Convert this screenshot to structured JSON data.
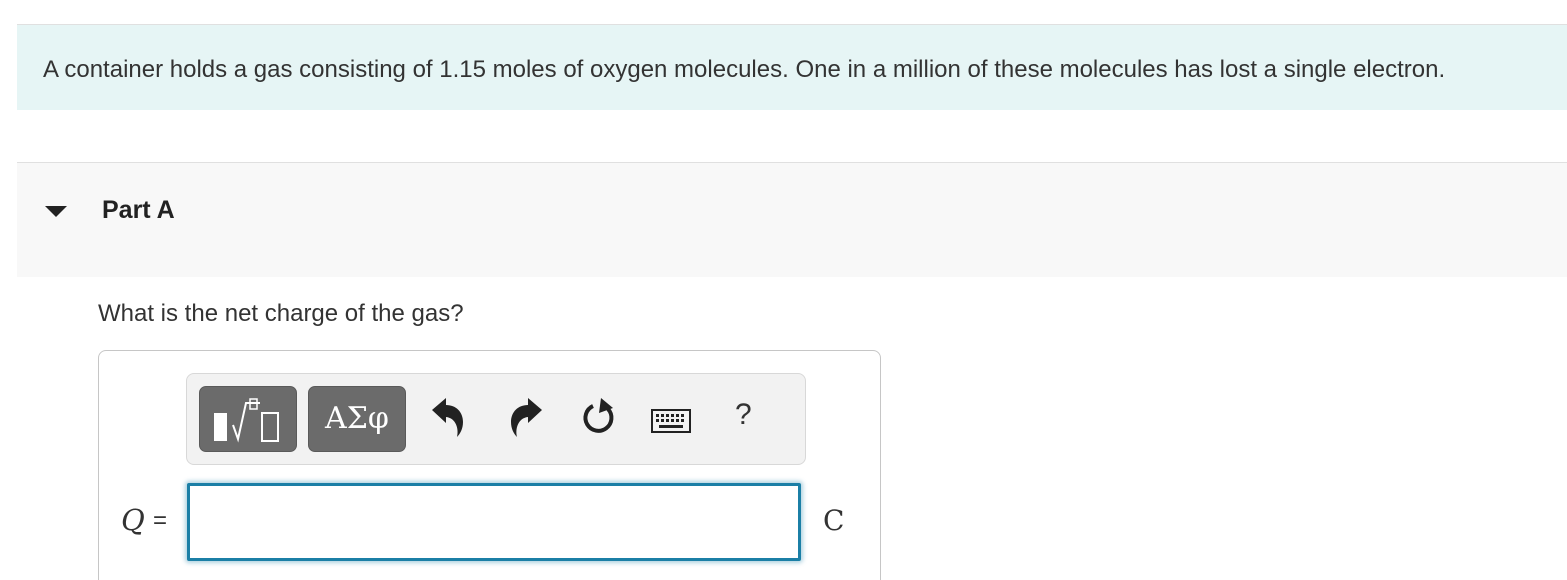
{
  "intro": {
    "text": "A container holds a gas consisting of 1.15 moles of oxygen molecules. One in a million of these molecules has lost a single electron."
  },
  "part": {
    "title": "Part A",
    "question": "What is the net charge of the gas?"
  },
  "toolbar": {
    "templates_icon": "templates-icon",
    "symbols_label": "ΑΣφ",
    "undo_icon": "undo-icon",
    "redo_icon": "redo-icon",
    "reset_icon": "reset-icon",
    "keyboard_icon": "keyboard-icon",
    "help_label": "?"
  },
  "answer": {
    "variable": "Q",
    "equals": "=",
    "value": "",
    "unit": "C"
  },
  "colors": {
    "intro_bg": "#e6f5f5",
    "part_header_bg": "#f8f8f8",
    "input_border": "#1b7fa6",
    "toolbar_button_bg": "#6b6b6b"
  }
}
